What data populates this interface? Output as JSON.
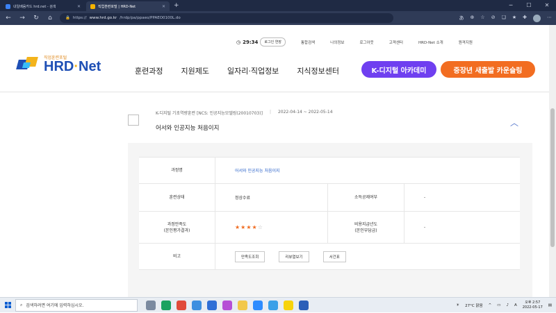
{
  "browser": {
    "tabs": [
      {
        "title": "내일배움카드 hrd.net - 검색",
        "active": false
      },
      {
        "title": "직업훈련포털 | HRD-Net",
        "active": true
      }
    ],
    "url_prefix": "https://",
    "url_host": "www.hrd.go.kr",
    "url_path": "/hrdp/pa/ppaeo/PPAEO0100L.do"
  },
  "utility": {
    "timer": "29:34",
    "extend_login": "로그인 연장",
    "links": [
      "통합검색",
      "나의정보",
      "로그아웃",
      "고객센터",
      "HRD-Net 소개",
      "원격지원"
    ]
  },
  "logo": {
    "sub": "직업훈련포털",
    "main_a": "HRD",
    "main_b": "Net"
  },
  "gnb": [
    "훈련과정",
    "지원제도",
    "일자리·직업정보",
    "지식정보센터"
  ],
  "pills": {
    "digital": "K-디지털 아카데미",
    "career": "중장년 새출발 카운슬링"
  },
  "course": {
    "category": "K-디지털 기초역량훈련 [NCS: 인공지능모델링(20010703)]",
    "period": "2022-04-14 ~ 2022-05-14",
    "title": "어서와 인공지능 처음이지"
  },
  "detail": {
    "course_name_label": "과정명",
    "course_name_value": "어서와 인공지능 처음이지",
    "status_label": "훈련상태",
    "status_value": "정상수료",
    "tax_label": "소득공제여부",
    "tax_value": "-",
    "satisfaction_label_1": "과정만족도",
    "satisfaction_label_2": "(본인평가결과)",
    "rating": 4,
    "rating_max": 5,
    "cost_label_1": "비용지급년도",
    "cost_label_2": "(본인부담금)",
    "cost_value": "-",
    "note_label": "비고",
    "btn_satisfaction": "만족도조회",
    "btn_review": "리뷰열보기",
    "btn_certificate": "서건표"
  },
  "taskbar": {
    "search_placeholder": "검색하려면 여기에 입력하십시오.",
    "weather": "27°C 맑음",
    "time": "오후 2:57",
    "date": "2022-05-17"
  }
}
